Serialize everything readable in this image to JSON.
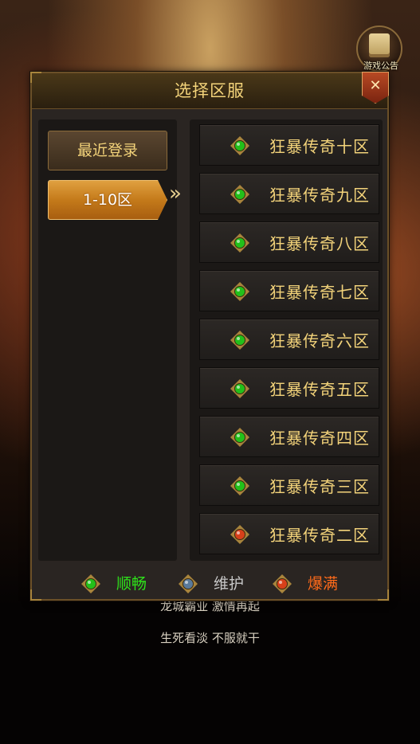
{
  "notice": {
    "label": "游戏公告"
  },
  "background_text": {
    "line1": "龙城霸业 激情再起",
    "line2": "生死看淡 不服就干"
  },
  "dialog": {
    "title": "选择区服",
    "close_label": "✕"
  },
  "categories": [
    {
      "label": "最近登录",
      "active": false
    },
    {
      "label": "1-10区",
      "active": true
    }
  ],
  "arrow_glyph": "»",
  "servers": [
    {
      "name": "狂暴传奇十区",
      "status": "smooth"
    },
    {
      "name": "狂暴传奇九区",
      "status": "smooth"
    },
    {
      "name": "狂暴传奇八区",
      "status": "smooth"
    },
    {
      "name": "狂暴传奇七区",
      "status": "smooth"
    },
    {
      "name": "狂暴传奇六区",
      "status": "smooth"
    },
    {
      "name": "狂暴传奇五区",
      "status": "smooth"
    },
    {
      "name": "狂暴传奇四区",
      "status": "smooth"
    },
    {
      "name": "狂暴传奇三区",
      "status": "smooth"
    },
    {
      "name": "狂暴传奇二区",
      "status": "full"
    }
  ],
  "legend": [
    {
      "label": "顺畅",
      "status": "smooth",
      "color": "#2ee31a"
    },
    {
      "label": "维护",
      "status": "maintenance",
      "color": "#c8c8c8"
    },
    {
      "label": "爆满",
      "status": "full",
      "color": "#ff6a1a"
    }
  ],
  "gem_colors": {
    "smooth": "#22c01a",
    "maintenance": "#5a7a9a",
    "full": "#d8401a"
  }
}
